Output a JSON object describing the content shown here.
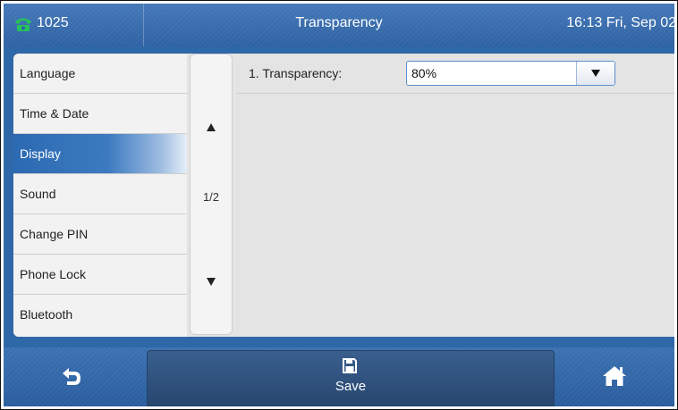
{
  "status_bar": {
    "line_icon": "phone-icon",
    "line_number": "1025",
    "title": "Transparency",
    "clock": "16:13 Fri, Sep 02"
  },
  "menu": {
    "items": [
      {
        "label": "Language"
      },
      {
        "label": "Time & Date"
      },
      {
        "label": "Display",
        "active": true
      },
      {
        "label": "Sound"
      },
      {
        "label": "Change PIN"
      },
      {
        "label": "Phone Lock"
      },
      {
        "label": "Bluetooth"
      }
    ],
    "page_indicator": "1/2"
  },
  "settings": {
    "transparency": {
      "label": "1. Transparency:",
      "value": "80%"
    }
  },
  "softkeys": {
    "back_icon": "back-arrow-icon",
    "save_icon": "floppy-disk-icon",
    "save_label": "Save",
    "home_icon": "home-icon"
  },
  "colors": {
    "bar_blue": "#2f68a8",
    "active_item": "#2b69b2",
    "phone_icon_green": "#25c25b"
  }
}
